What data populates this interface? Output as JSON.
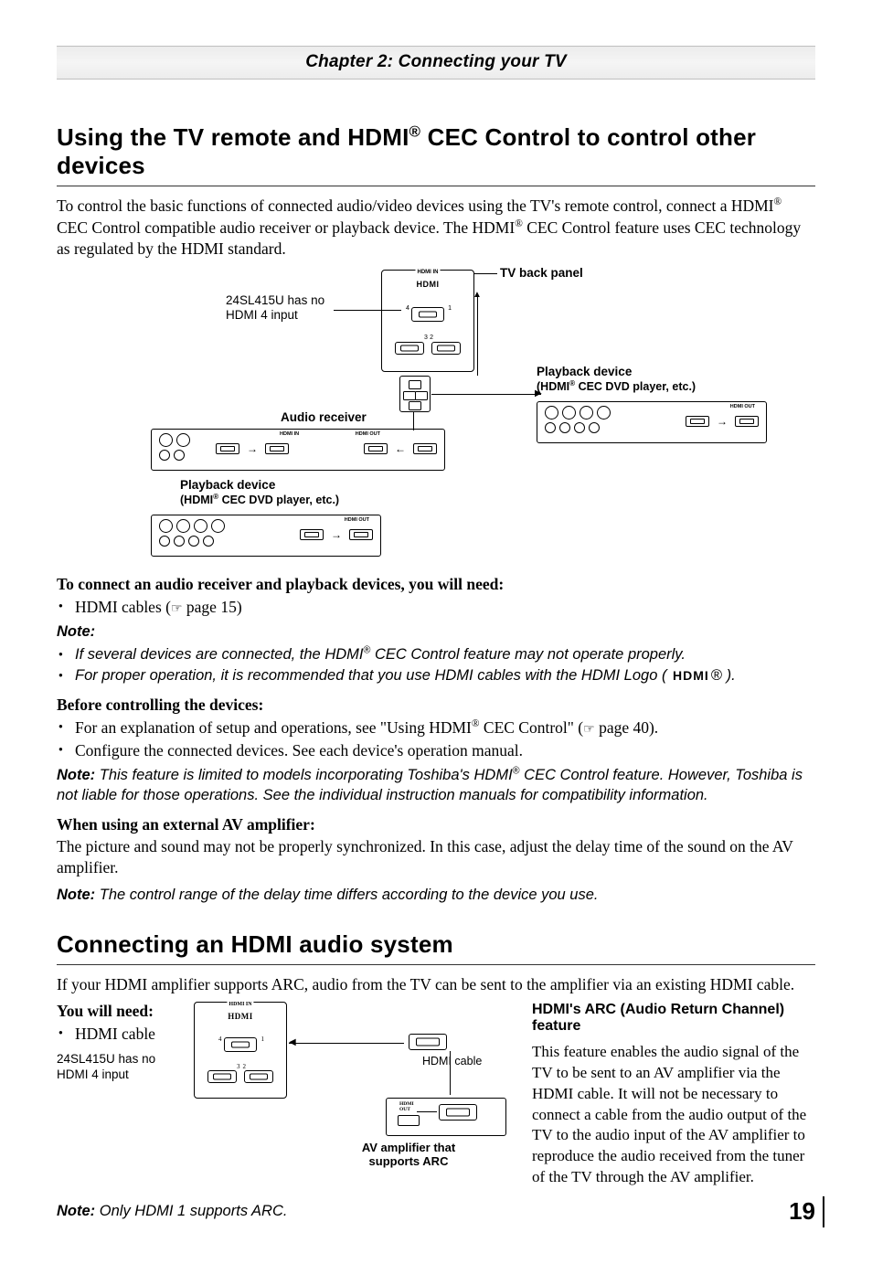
{
  "chapter": {
    "title": "Chapter 2: Connecting your TV"
  },
  "section1": {
    "heading_pre": "Using the TV remote and HDMI",
    "heading_post": " CEC Control to control other devices",
    "intro_pre": "To control the basic functions of connected audio/video devices using the TV's remote control, connect a HDMI",
    "intro_mid": " CEC Control compatible audio receiver or playback device. The HDMI",
    "intro_post": " CEC Control feature uses CEC technology as regulated by the HDMI standard.",
    "diag": {
      "tv_back_panel": "TV back panel",
      "no_hdmi4_a": "24SL415U has no",
      "no_hdmi4_b": "HDMI 4 input",
      "audio_receiver": "Audio receiver",
      "playback_device": "Playback device",
      "cec_dvd_pre": "(HDMI",
      "cec_dvd_post": " CEC DVD player, etc.)",
      "hdmi_in": "HDMI IN",
      "hdmi_word": "HDMI"
    },
    "need_heading": "To connect an audio receiver and playback devices, you will need:",
    "need_item_pre": "HDMI cables (",
    "need_item_post": " page 15)",
    "note_heading": "Note:",
    "note1_pre": "If several devices are connected, the HDMI",
    "note1_post": " CEC Control feature may not operate properly.",
    "note2": "For proper operation, it is recommended that you use HDMI cables with the HDMI Logo ( ",
    "note2_logo": "HDMI",
    "note2_end": " ).",
    "before_heading": "Before controlling the devices:",
    "before1_pre": "For an explanation of setup and operations, see \"Using HDMI",
    "before1_mid": " CEC Control\" (",
    "before1_post": " page 40).",
    "before2": "Configure the connected devices. See each device's operation manual.",
    "note3_pre": "This feature is limited to models incorporating Toshiba's HDMI",
    "note3_post": " CEC Control feature. However, Toshiba is not liable for those operations. See the individual instruction manuals for compatibility information.",
    "amp_heading": "When using an external AV amplifier:",
    "amp_text": "The picture and sound may not be properly synchronized. In this case, adjust the delay time of the sound on the AV amplifier.",
    "note4": "The control range of the delay time differs according to the device you use."
  },
  "section2": {
    "heading": "Connecting an HDMI audio system",
    "intro": "If your HDMI amplifier supports ARC, audio from the TV can be sent to the amplifier via an existing HDMI cable.",
    "need_heading": "You will need:",
    "need_item": "HDMI cable",
    "no_hdmi4_a": "24SL415U has no",
    "no_hdmi4_b": "HDMI 4 input",
    "hdmi_cable_label": "HDMI cable",
    "amp_label_a": "AV amplifier that",
    "amp_label_b": "supports ARC",
    "arc_heading": "HDMI's ARC (Audio Return Channel) feature",
    "arc_text": "This feature enables the audio signal of the TV to be sent to an AV amplifier via the HDMI cable. It will not be necessary to connect a cable from the audio output of the TV to the audio input of the AV amplifier to reproduce the audio received from the tuner of the TV through the AV amplifier.",
    "note5": "Only HDMI 1 supports ARC.",
    "hdmi_in": "HDMI IN",
    "hdmi_word": "HDMI"
  },
  "page_number": "19",
  "glyphs": {
    "pointer": "☞",
    "reg": "®"
  }
}
